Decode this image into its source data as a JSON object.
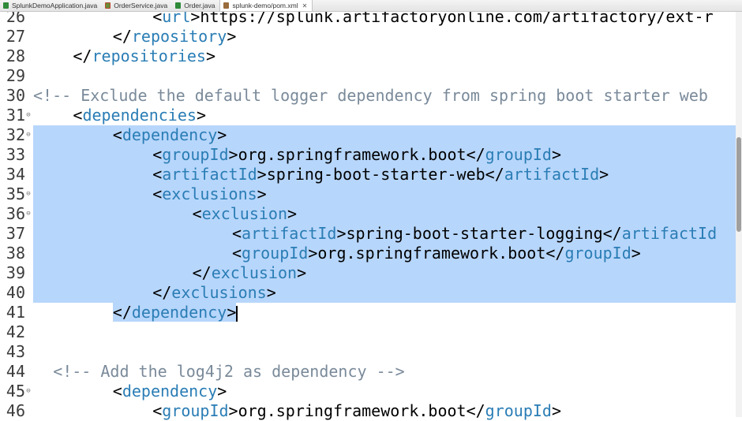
{
  "tabs": [
    {
      "label": "SplunkDemoApplication.java",
      "icon": "java-file-icon",
      "active": false
    },
    {
      "label": "OrderService.java",
      "icon": "java-file-error-icon",
      "active": false
    },
    {
      "label": "Order.java",
      "icon": "java-file-icon",
      "active": false
    },
    {
      "label": "splunk-demo/pom.xml",
      "icon": "xml-file-icon",
      "active": true,
      "close": "✕"
    }
  ],
  "editor": {
    "lines": [
      {
        "num": "26",
        "indent": 6,
        "fold": "",
        "selected": false,
        "tokens": [
          [
            "punct",
            "<"
          ],
          [
            "tagname",
            "url"
          ],
          [
            "punct",
            ">"
          ],
          [
            "text",
            "https://splunk.artifactoryonline.com/artifactory/ext-r"
          ]
        ]
      },
      {
        "num": "27",
        "indent": 4,
        "fold": "",
        "selected": false,
        "tokens": [
          [
            "punct",
            "</"
          ],
          [
            "tagname",
            "repository"
          ],
          [
            "punct",
            ">"
          ]
        ]
      },
      {
        "num": "28",
        "indent": 2,
        "fold": "",
        "selected": false,
        "tokens": [
          [
            "punct",
            "</"
          ],
          [
            "tagname",
            "repositories"
          ],
          [
            "punct",
            ">"
          ]
        ]
      },
      {
        "num": "29",
        "indent": 0,
        "fold": "",
        "selected": false,
        "tokens": []
      },
      {
        "num": "30",
        "indent": 0,
        "fold": "",
        "selected": false,
        "tokens": [
          [
            "comment",
            "<!-- Exclude the default logger dependency from spring boot starter web"
          ]
        ]
      },
      {
        "num": "31",
        "indent": 2,
        "fold": "⊖",
        "selected": false,
        "tokens": [
          [
            "punct",
            "<"
          ],
          [
            "tagname",
            "dependencies"
          ],
          [
            "punct",
            ">"
          ]
        ]
      },
      {
        "num": "32",
        "indent": 4,
        "fold": "⊖",
        "selected": true,
        "tokens": [
          [
            "punct",
            "<"
          ],
          [
            "tagname",
            "dependency"
          ],
          [
            "punct",
            ">"
          ]
        ]
      },
      {
        "num": "33",
        "indent": 6,
        "fold": "",
        "selected": true,
        "tokens": [
          [
            "punct",
            "<"
          ],
          [
            "tagname",
            "groupId"
          ],
          [
            "punct",
            ">"
          ],
          [
            "text",
            "org.springframework.boot"
          ],
          [
            "punct",
            "</"
          ],
          [
            "tagname",
            "groupId"
          ],
          [
            "punct",
            ">"
          ]
        ]
      },
      {
        "num": "34",
        "indent": 6,
        "fold": "",
        "selected": true,
        "tokens": [
          [
            "punct",
            "<"
          ],
          [
            "tagname",
            "artifactId"
          ],
          [
            "punct",
            ">"
          ],
          [
            "text",
            "spring-boot-starter-web"
          ],
          [
            "punct",
            "</"
          ],
          [
            "tagname",
            "artifactId"
          ],
          [
            "punct",
            ">"
          ]
        ]
      },
      {
        "num": "35",
        "indent": 6,
        "fold": "⊖",
        "selected": true,
        "tokens": [
          [
            "punct",
            "<"
          ],
          [
            "tagname",
            "exclusions"
          ],
          [
            "punct",
            ">"
          ]
        ]
      },
      {
        "num": "36",
        "indent": 8,
        "fold": "⊖",
        "selected": true,
        "tokens": [
          [
            "punct",
            "<"
          ],
          [
            "tagname",
            "exclusion"
          ],
          [
            "punct",
            ">"
          ]
        ]
      },
      {
        "num": "37",
        "indent": 10,
        "fold": "",
        "selected": true,
        "tokens": [
          [
            "punct",
            "<"
          ],
          [
            "tagname",
            "artifactId"
          ],
          [
            "punct",
            ">"
          ],
          [
            "text",
            "spring-boot-starter-logging"
          ],
          [
            "punct",
            "</"
          ],
          [
            "tagname",
            "artifactId"
          ]
        ]
      },
      {
        "num": "38",
        "indent": 10,
        "fold": "",
        "selected": true,
        "tokens": [
          [
            "punct",
            "<"
          ],
          [
            "tagname",
            "groupId"
          ],
          [
            "punct",
            ">"
          ],
          [
            "text",
            "org.springframework.boot"
          ],
          [
            "punct",
            "</"
          ],
          [
            "tagname",
            "groupId"
          ],
          [
            "punct",
            ">"
          ]
        ]
      },
      {
        "num": "39",
        "indent": 8,
        "fold": "",
        "selected": true,
        "tokens": [
          [
            "punct",
            "</"
          ],
          [
            "tagname",
            "exclusion"
          ],
          [
            "punct",
            ">"
          ]
        ]
      },
      {
        "num": "40",
        "indent": 6,
        "fold": "",
        "selected": true,
        "tokens": [
          [
            "punct",
            "</"
          ],
          [
            "tagname",
            "exclusions"
          ],
          [
            "punct",
            ">"
          ]
        ]
      },
      {
        "num": "41",
        "indent": 4,
        "fold": "",
        "selected": true,
        "partial": true,
        "caret": true,
        "tokens": [
          [
            "punct",
            "</"
          ],
          [
            "tagname",
            "dependency"
          ],
          [
            "punct",
            ">"
          ]
        ]
      },
      {
        "num": "42",
        "indent": 0,
        "fold": "",
        "selected": false,
        "tokens": []
      },
      {
        "num": "43",
        "indent": 0,
        "fold": "",
        "selected": false,
        "tokens": []
      },
      {
        "num": "44",
        "indent": 1,
        "fold": "",
        "selected": false,
        "tokens": [
          [
            "comment",
            "<!-- Add the log4j2 as dependency -->"
          ]
        ]
      },
      {
        "num": "45",
        "indent": 4,
        "fold": "⊖",
        "selected": false,
        "tokens": [
          [
            "punct",
            "<"
          ],
          [
            "tagname",
            "dependency"
          ],
          [
            "punct",
            ">"
          ]
        ]
      },
      {
        "num": "46",
        "indent": 6,
        "fold": "",
        "selected": false,
        "tokens": [
          [
            "punct",
            "<"
          ],
          [
            "tagname",
            "groupId"
          ],
          [
            "punct",
            ">"
          ],
          [
            "text",
            "org.springframework.boot"
          ],
          [
            "punct",
            "</"
          ],
          [
            "tagname",
            "groupId"
          ],
          [
            "punct",
            ">"
          ]
        ]
      }
    ]
  }
}
